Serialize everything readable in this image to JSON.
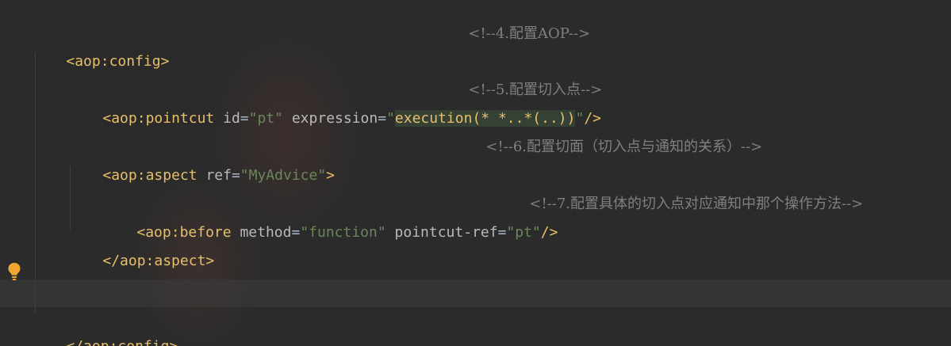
{
  "comments": {
    "c4": "<!--4.配置AOP-->",
    "c5": "<!--5.配置切入点-->",
    "c6": "<!--6.配置切面（切入点与通知的关系）-->",
    "c7": "<!--7.配置具体的切入点对应通知中那个操作方法-->"
  },
  "config": {
    "open_lt": "<",
    "prefix": "aop",
    "colon": ":",
    "name": "config",
    "open_gt": ">",
    "close_open": "</",
    "close_gt": ">"
  },
  "pointcut": {
    "prefix": "aop",
    "name": "pointcut",
    "attr_id": "id",
    "id_value": "\"pt\"",
    "attr_expression": "expression",
    "q1": "\"",
    "expr_value": "execution(* *..*(..))",
    "q2": "\"",
    "end": "/>"
  },
  "aspect": {
    "prefix": "aop",
    "name": "aspect",
    "attr_ref": "ref",
    "ref_value": "\"MyAdvice\"",
    "end": ">",
    "close": "</aop:aspect>"
  },
  "before": {
    "prefix": "aop",
    "name": "before",
    "attr_method": "method",
    "method_value": "\"function\"",
    "attr_pointcut_ref": "pointcut-ref",
    "pointcut_ref_value": "\"pt\"",
    "end": "/>"
  },
  "symbols": {
    "lt": "<",
    "colon": ":",
    "eq": "=",
    "space": " "
  },
  "icons": {
    "intention": "lightbulb-icon"
  },
  "colors": {
    "background": "#2b2b2b",
    "tag": "#e8bf6a",
    "attribute": "#bababa",
    "string": "#6a8759",
    "comment": "#808080",
    "text": "#a9b7c6",
    "highlight": "#344134",
    "bulb": "#f0a732"
  }
}
